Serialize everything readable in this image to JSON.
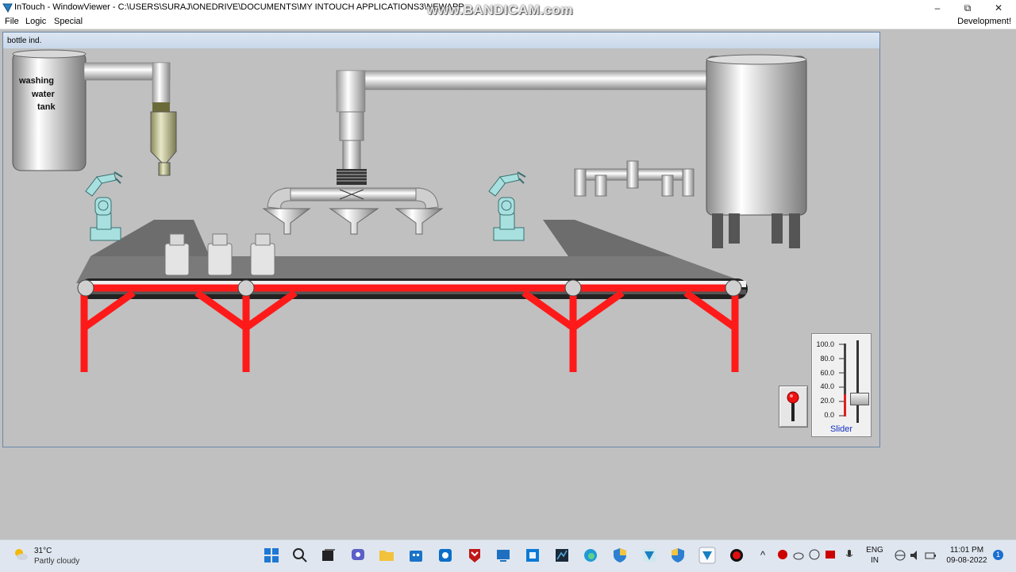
{
  "window": {
    "title": "InTouch - WindowViewer - C:\\USERS\\SURAJ\\ONEDRIVE\\DOCUMENTS\\MY INTOUCH APPLICATIONS3\\NEWAPP",
    "minimize": "–",
    "maximize": "⧉",
    "close": "✕"
  },
  "watermark": "www.BANDICAM.com",
  "menu": {
    "items": [
      "File",
      "Logic",
      "Special"
    ],
    "mode": "Development!"
  },
  "hmi_window": {
    "title": "bottle ind."
  },
  "tank_label": [
    "washing",
    "water",
    "tank"
  ],
  "slider": {
    "ticks": [
      "100.0",
      "80.0",
      "60.0",
      "40.0",
      "20.0",
      "0.0"
    ],
    "caption": "Slider",
    "value": 0.0
  },
  "switch": {
    "state": "off"
  },
  "colors": {
    "frame_red": "#ff1a1a",
    "background": "#c0c0c0",
    "robot_cyan": "#a8e0e0"
  },
  "taskbar": {
    "weather_temp": "31°C",
    "weather_desc": "Partly cloudy",
    "lang_top": "ENG",
    "lang_bottom": "IN",
    "time": "11:01 PM",
    "date": "09-08-2022",
    "notification_count": "1",
    "icons": [
      "start-icon",
      "search-icon",
      "task-view-icon",
      "chat-icon",
      "file-explorer-icon",
      "store-icon",
      "app-icon",
      "mcafee-icon",
      "app2-icon",
      "app3-icon",
      "app4-icon",
      "edge-icon",
      "security-icon",
      "intouch-icon",
      "shield-icon",
      "intouch-viewer-icon",
      "bandicam-record-icon"
    ]
  }
}
